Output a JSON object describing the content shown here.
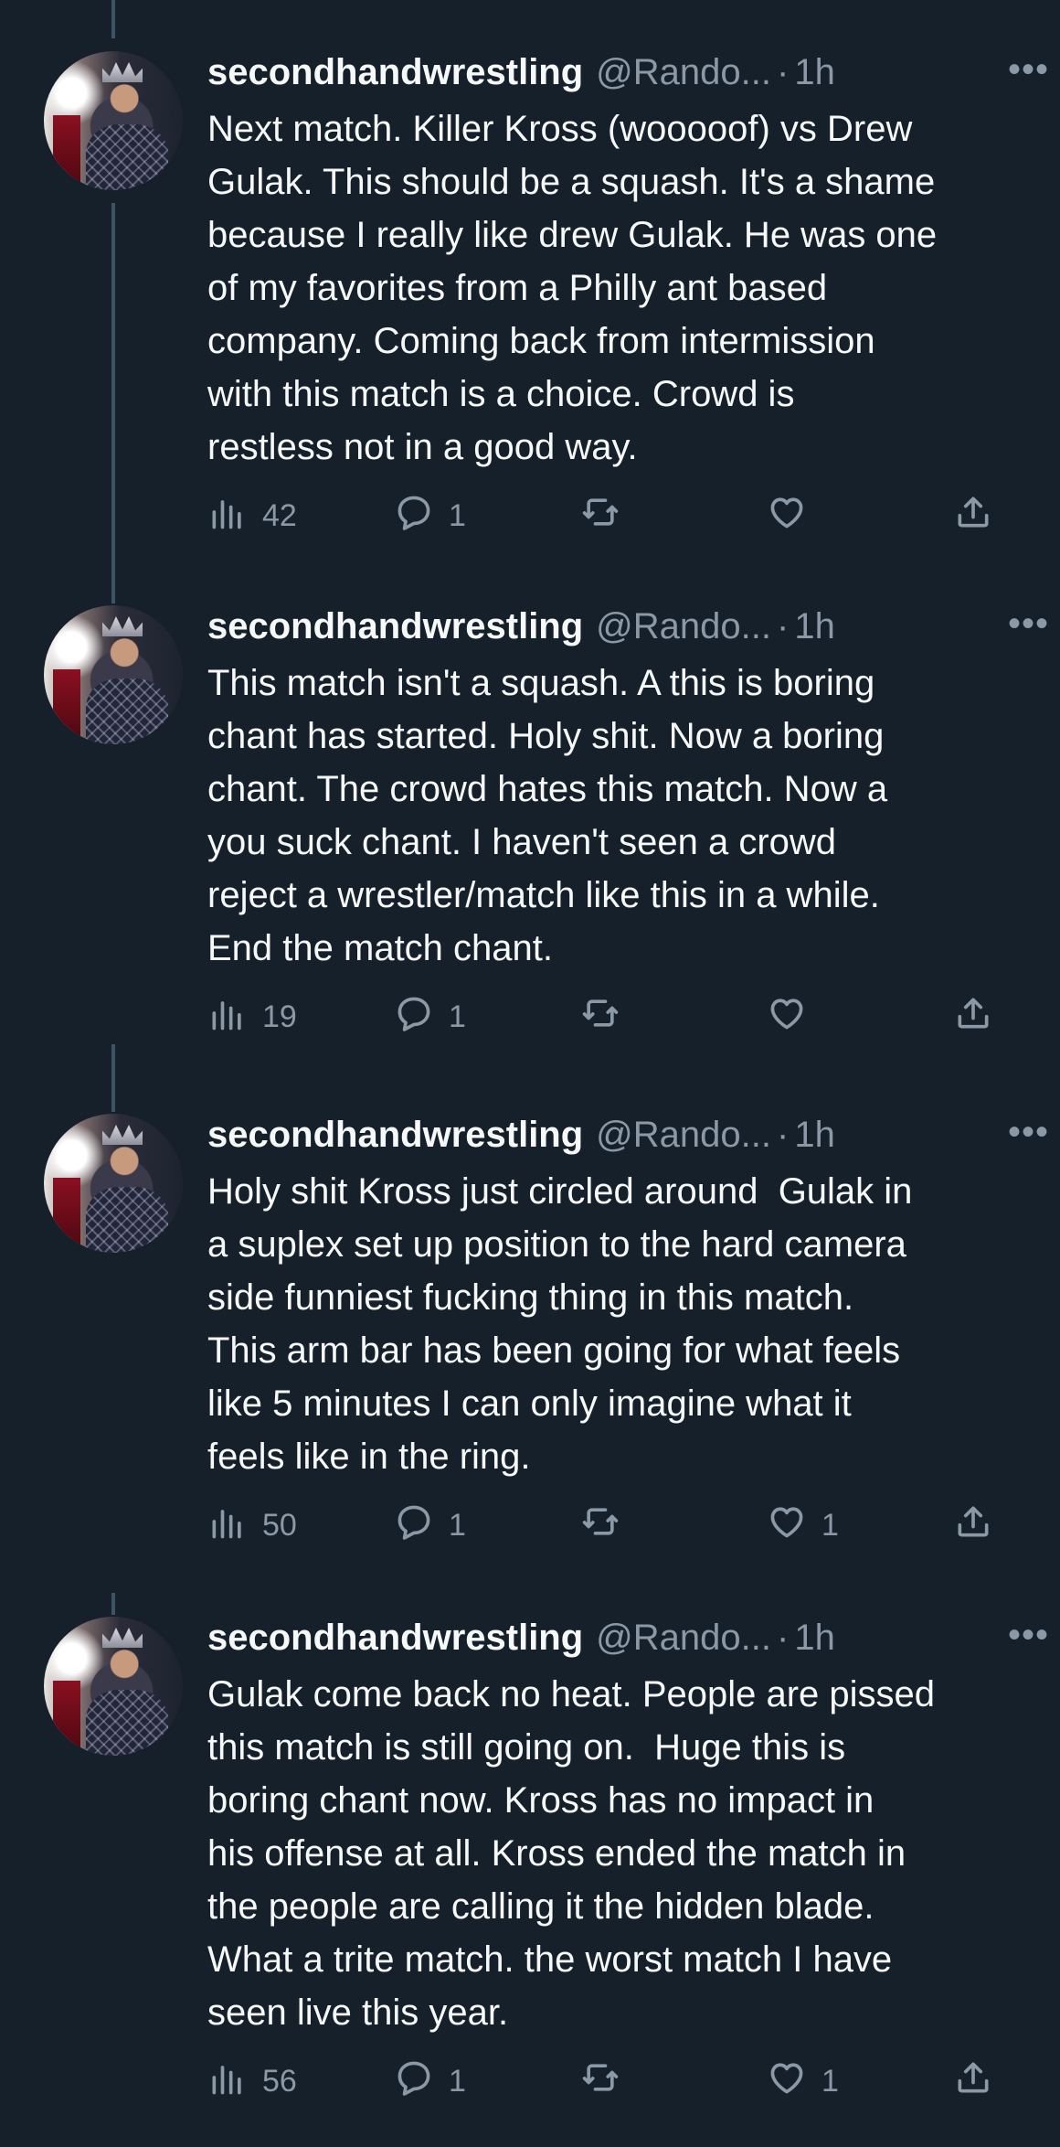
{
  "tweets": [
    {
      "name": "secondhandwrestling",
      "handle": "@Rando...",
      "separator": "·",
      "time": "1h",
      "text": "Next match. Killer Kross (wooooof) vs Drew\nGulak. This should be a squash. It's a shame\nbecause I really like drew Gulak. He was one\nof my favorites from a Philly ant based\ncompany. Coming back from intermission\nwith this match is a choice. Crowd is\nrestless not in a good way.",
      "views": "42",
      "replies": "1",
      "retweets": "",
      "likes": ""
    },
    {
      "name": "secondhandwrestling",
      "handle": "@Rando...",
      "separator": "·",
      "time": "1h",
      "text": "This match isn't a squash. A this is boring\nchant has started. Holy shit. Now a boring\nchant. The crowd hates this match. Now a\nyou suck chant. I haven't seen a crowd\nreject a wrestler/match like this in a while.\nEnd the match chant.",
      "views": "19",
      "replies": "1",
      "retweets": "",
      "likes": ""
    },
    {
      "name": "secondhandwrestling",
      "handle": "@Rando...",
      "separator": "·",
      "time": "1h",
      "text": "Holy shit Kross just circled around  Gulak in\na suplex set up position to the hard camera\nside funniest fucking thing in this match.\nThis arm bar has been going for what feels\nlike 5 minutes I can only imagine what it\nfeels like in the ring.",
      "views": "50",
      "replies": "1",
      "retweets": "",
      "likes": "1"
    },
    {
      "name": "secondhandwrestling",
      "handle": "@Rando...",
      "separator": "·",
      "time": "1h",
      "text": "Gulak come back no heat. People are pissed\nthis match is still going on.  Huge this is\nboring chant now. Kross has no impact in\nhis offense at all. Kross ended the match in\nthe people are calling it the hidden blade.\nWhat a trite match. the worst match I have\nseen live this year.",
      "views": "56",
      "replies": "1",
      "retweets": "",
      "likes": "1"
    }
  ],
  "more_glyph": "•••",
  "icons": {
    "views": "views-icon",
    "reply": "reply-icon",
    "retweet": "retweet-icon",
    "like": "heart-icon",
    "share": "share-icon",
    "more": "more-icon"
  },
  "colors": {
    "background": "#15202b",
    "text": "#f7f9f9",
    "secondary": "#8b98a5",
    "thread_line": "#3d5466"
  }
}
